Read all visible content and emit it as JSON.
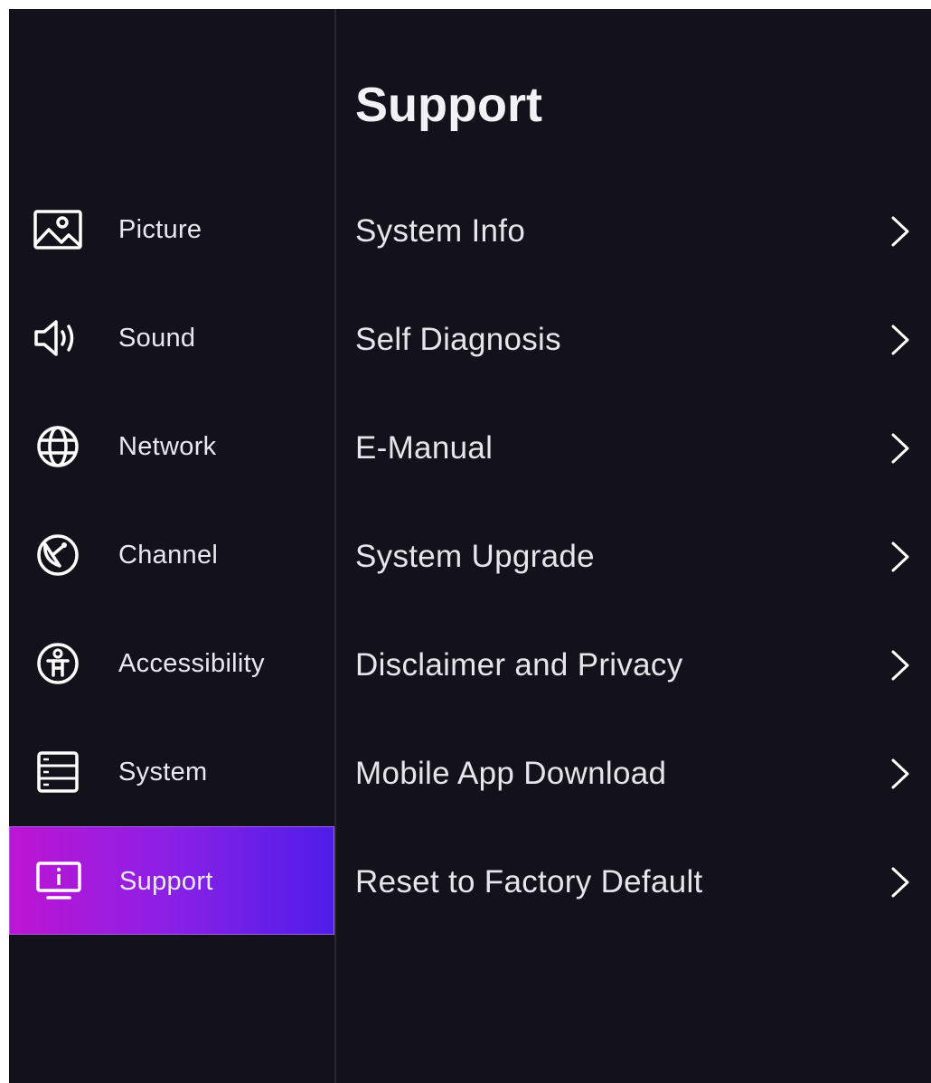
{
  "sidebar": {
    "items": [
      {
        "label": "Picture",
        "icon": "picture-icon",
        "active": false
      },
      {
        "label": "Sound",
        "icon": "speaker-icon",
        "active": false
      },
      {
        "label": "Network",
        "icon": "globe-icon",
        "active": false
      },
      {
        "label": "Channel",
        "icon": "satellite-dish-icon",
        "active": false
      },
      {
        "label": "Accessibility",
        "icon": "accessibility-icon",
        "active": false
      },
      {
        "label": "System",
        "icon": "system-list-icon",
        "active": false
      },
      {
        "label": "Support",
        "icon": "info-monitor-icon",
        "active": true
      }
    ]
  },
  "main": {
    "title": "Support",
    "items": [
      {
        "label": "System Info"
      },
      {
        "label": "Self Diagnosis"
      },
      {
        "label": "E-Manual"
      },
      {
        "label": "System Upgrade"
      },
      {
        "label": "Disclaimer and Privacy"
      },
      {
        "label": "Mobile App Download"
      },
      {
        "label": "Reset to Factory Default"
      }
    ],
    "chevron_icon": "chevron-right-icon"
  },
  "colors": {
    "background": "#13111a",
    "active_gradient_start": "#bd15d2",
    "active_gradient_end": "#4d1ee8",
    "text": "#e9e8ee"
  }
}
